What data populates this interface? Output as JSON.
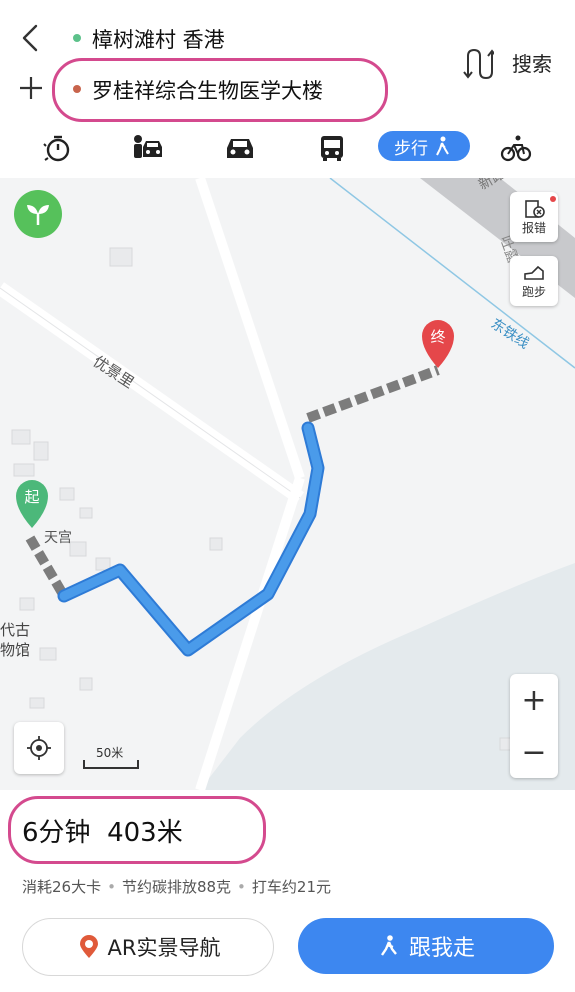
{
  "header": {
    "origin": "樟树滩村 香港",
    "destination": "罗桂祥综合生物医学大楼",
    "search_label": "搜索",
    "icons": [
      "back-chevron-icon",
      "plus-icon",
      "swap-route-icon"
    ],
    "colors": {
      "origin_dot": "#5cc18a",
      "destination_dot": "#c8644c",
      "highlight": "#d44a8e"
    }
  },
  "modes": {
    "icons": [
      "timer-icon",
      "taxi-icon",
      "car-icon",
      "bus-icon",
      "walk-icon",
      "bike-icon"
    ],
    "active_label": "步行",
    "active_color": "#3d87f0"
  },
  "map": {
    "labels": {
      "street_1": "优景里",
      "poi_1": "天宫",
      "museum": "代古\n物馆",
      "railway": "东铁线",
      "street_top": "新路",
      "street_top2": "吐露",
      "start": "起",
      "end": "终"
    },
    "report_label": "报错",
    "run_label": "跑步",
    "scale_label": "50米",
    "zoom_in": "+",
    "zoom_out": "−",
    "colors": {
      "route": "#4a9bea",
      "dashed": "#7c7c7c",
      "start_pin": "#4cb87a",
      "end_pin": "#e5474a",
      "water": "#e4eaed"
    }
  },
  "summary": {
    "text": "6分钟  403米",
    "calories": "消耗26大卡",
    "carbon": "节约碳排放88克",
    "taxi": "打车约21元"
  },
  "actions": {
    "ar_label": "AR实景导航",
    "go_label": "跟我走"
  }
}
